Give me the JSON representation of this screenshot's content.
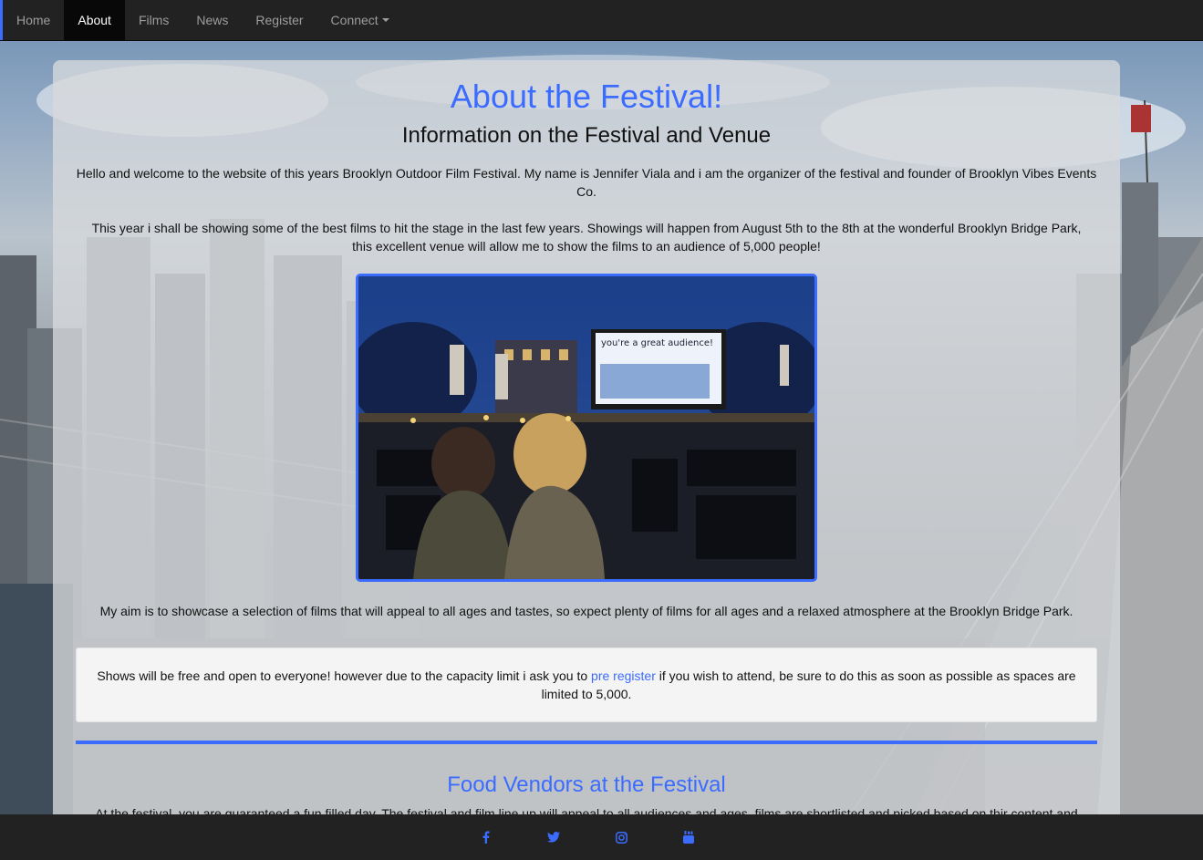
{
  "nav": {
    "items": [
      {
        "label": "Home",
        "active": false
      },
      {
        "label": "About",
        "active": true
      },
      {
        "label": "Films",
        "active": false
      },
      {
        "label": "News",
        "active": false
      },
      {
        "label": "Register",
        "active": false
      },
      {
        "label": "Connect",
        "active": false,
        "dropdown": true
      }
    ]
  },
  "main": {
    "title": "About the Festival!",
    "subtitle": "Information on the Festival and Venue",
    "intro": "Hello and welcome to the website of this years Brooklyn Outdoor Film Festival. My name is Jennifer Viala and i am the organizer of the festival and founder of Brooklyn Vibes Events Co.",
    "showings": "This year i shall be showing some of the best films to hit the stage in the last few years. Showings will happen from August 5th to the 8th at the wonderful Brooklyn Bridge Park, this excellent venue will allow me to show the films to an audience of 5,000 people!",
    "hero_screen_text": "you're a great audience!",
    "aim": "My aim is to showcase a selection of films that will appeal to all ages and tastes, so expect plenty of films for all ages and a relaxed atmosphere at the Brooklyn Bridge Park.",
    "notice": {
      "before": "Shows will be free and open to everyone! however due to the capacity limit i ask you to ",
      "link": "pre register",
      "after": " if you wish to attend, be sure to do this as soon as possible as spaces are limited to 5,000."
    },
    "food_title": "Food Vendors at the Festival",
    "food_text": "At the festival, you are guaranteed a fun filled day. The festival and film line up will appeal to all audiences and ages, films are shortlisted and picked based on thir content and entertainment value. Refreshments and drinks will be on offer throughout the festival, from hotdogs, pizza, and hundreds of veggie options! see below for a list of refreshment vendors"
  },
  "footer": {
    "icons": [
      "facebook-icon",
      "twitter-icon",
      "instagram-icon",
      "youtube-icon"
    ]
  },
  "colors": {
    "accent": "#3b6cff",
    "navbar": "#222222",
    "panel": "rgba(215,218,221,0.78)"
  }
}
